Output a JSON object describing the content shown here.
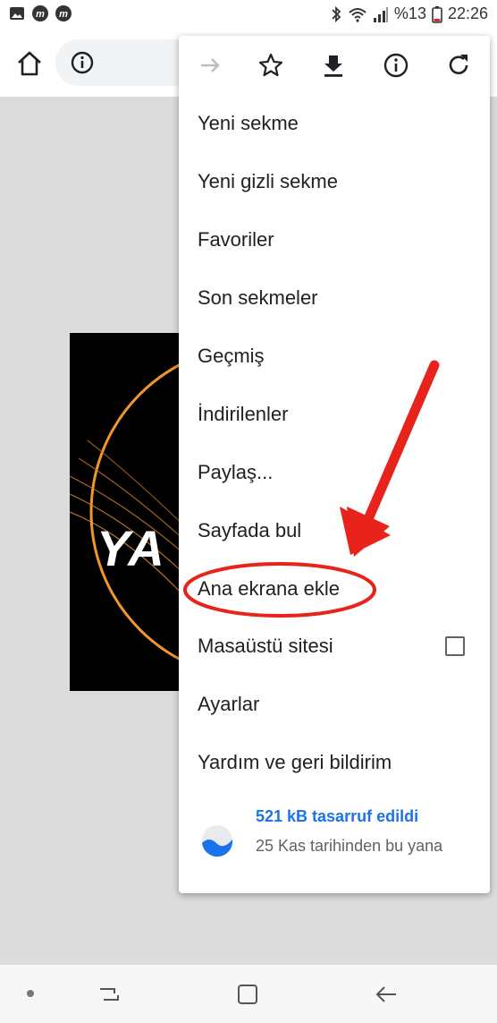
{
  "status_bar": {
    "battery_text": "%13",
    "time": "22:26",
    "icons": [
      "image-icon",
      "m-app-icon",
      "m-app-icon",
      "bluetooth-icon",
      "wifi-icon",
      "signal-icon",
      "battery-icon"
    ]
  },
  "toolbar": {
    "icons": [
      "home-icon",
      "info-icon"
    ]
  },
  "banner": {
    "text": "YA"
  },
  "menu": {
    "top_icons": [
      "forward-icon",
      "star-icon",
      "download-icon",
      "info-icon",
      "reload-icon"
    ],
    "items": [
      {
        "label": "Yeni sekme"
      },
      {
        "label": "Yeni gizli sekme"
      },
      {
        "label": "Favoriler"
      },
      {
        "label": "Son sekmeler"
      },
      {
        "label": "Geçmiş"
      },
      {
        "label": "İndirilenler"
      },
      {
        "label": "Paylaş..."
      },
      {
        "label": "Sayfada bul"
      },
      {
        "label": "Ana ekrana ekle"
      },
      {
        "label": "Masaüstü sitesi",
        "checkbox": false
      },
      {
        "label": "Ayarlar"
      },
      {
        "label": "Yardım ve geri bildirim"
      }
    ],
    "data_saver": {
      "title": "521 kB tasarruf edildi",
      "subtitle": "25 Kas tarihinden bu yana"
    }
  },
  "colors": {
    "accent": "#1a73e8",
    "annotation": "#e8231b",
    "menu_bg": "#ffffff",
    "page_bg": "#dcdcdc",
    "banner_ring": "#f0962a"
  },
  "navbar": {
    "icons": [
      "dot-icon",
      "recent-apps-icon",
      "home-square-icon",
      "back-icon"
    ]
  }
}
